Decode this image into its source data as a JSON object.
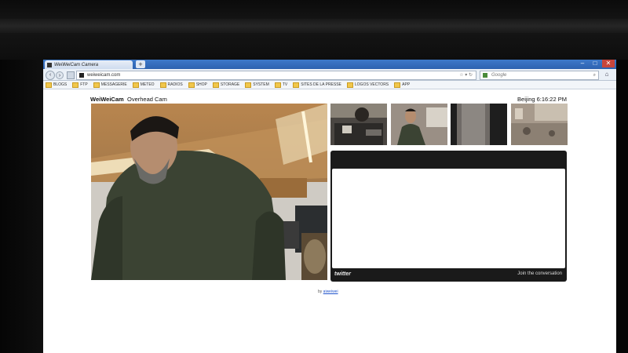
{
  "browser": {
    "tab_title": "WeiWeiCam Camera",
    "new_tab_symbol": "+",
    "window_controls": {
      "minimize": "–",
      "maximize": "□",
      "close": "✕"
    },
    "nav": {
      "back": "‹",
      "forward": "›"
    },
    "url": "weiweicam.com",
    "url_tools": "☆ ▾ ↻",
    "search_placeholder": "Google",
    "search_go": "⌕",
    "home": "⌂",
    "bookmarks": [
      "BLOGS",
      "FTP",
      "MESSAGERIE",
      "METEO",
      "RADIOS",
      "SHOP",
      "STORAGE",
      "SYSTEM",
      "TV",
      "SITES DE LA PRESSE",
      "LOGOS VECTORS",
      "APP"
    ]
  },
  "page": {
    "site_title": "WeiWeiCam",
    "camera_name": "Overhead Cam",
    "clock": "Beijing 6:16:22 PM",
    "thumbnails": [
      "desk-cam",
      "office-cam",
      "door-cam",
      "courtyard-cam"
    ],
    "twitter": {
      "logo": "twitter",
      "join_text": "Join the conversation"
    },
    "footer_prefix": "by",
    "footer_link": "aiweiwei"
  },
  "colors": {
    "tabstrip": "#2d62b0",
    "widget_dark": "#1a1a1a",
    "close_button": "#c8453c"
  }
}
